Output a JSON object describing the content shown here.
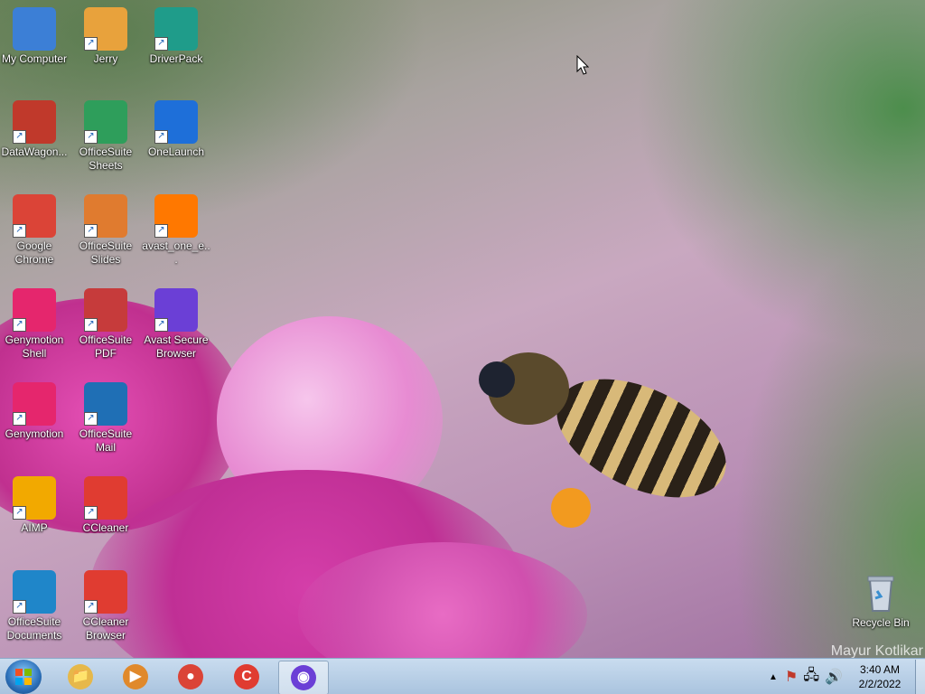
{
  "desktop": {
    "icons": [
      {
        "label": "My Computer",
        "icon": "computer-icon",
        "color": "#3c7fd6"
      },
      {
        "label": "Jerry",
        "icon": "jerry-icon",
        "color": "#e8a23c"
      },
      {
        "label": "DriverPack",
        "icon": "driverpack-icon",
        "color": "#1f9c8a"
      },
      {
        "label": "DataWagon...",
        "icon": "datawagon-icon",
        "color": "#c0392b"
      },
      {
        "label": "OfficeSuite Sheets",
        "icon": "sheets-icon",
        "color": "#2e9e5b"
      },
      {
        "label": "OneLaunch",
        "icon": "onelaunch-icon",
        "color": "#1e6fd9"
      },
      {
        "label": "Google Chrome",
        "icon": "chrome-icon",
        "color": "#db4437"
      },
      {
        "label": "OfficeSuite Slides",
        "icon": "slides-icon",
        "color": "#e07b2f"
      },
      {
        "label": "avast_one_e...",
        "icon": "avast-installer-icon",
        "color": "#ff7800"
      },
      {
        "label": "Genymotion Shell",
        "icon": "genymotion-shell-icon",
        "color": "#e5266d"
      },
      {
        "label": "OfficeSuite PDF",
        "icon": "pdf-icon",
        "color": "#c63b3b"
      },
      {
        "label": "Avast Secure Browser",
        "icon": "avast-browser-icon",
        "color": "#6b3fd6"
      },
      {
        "label": "Genymotion",
        "icon": "genymotion-icon",
        "color": "#e5266d"
      },
      {
        "label": "OfficeSuite Mail",
        "icon": "mail-icon",
        "color": "#1f6fb5"
      },
      {
        "label": "AIMP",
        "icon": "aimp-icon",
        "color": "#f2a900"
      },
      {
        "label": "CCleaner",
        "icon": "ccleaner-icon",
        "color": "#e03c31"
      },
      {
        "label": "OfficeSuite Documents",
        "icon": "documents-icon",
        "color": "#1f86c9"
      },
      {
        "label": "CCleaner Browser",
        "icon": "ccleaner-browser-icon",
        "color": "#e03c31"
      }
    ],
    "recycle_bin": {
      "label": "Recycle Bin",
      "icon": "recycle-bin-icon"
    },
    "watermark": "Mayur Kotlikar"
  },
  "taskbar": {
    "start": {
      "icon": "windows-start-icon"
    },
    "pinned": [
      {
        "icon": "file-explorer-icon",
        "name": "File Explorer"
      },
      {
        "icon": "media-player-icon",
        "name": "Media Player"
      },
      {
        "icon": "chrome-icon",
        "name": "Google Chrome"
      },
      {
        "icon": "ccleaner-browser-icon",
        "name": "CCleaner Browser"
      },
      {
        "icon": "avast-browser-icon",
        "name": "Avast Secure Browser",
        "active": true
      }
    ],
    "tray": {
      "time": "3:40 AM",
      "date": "2/2/2022"
    }
  }
}
